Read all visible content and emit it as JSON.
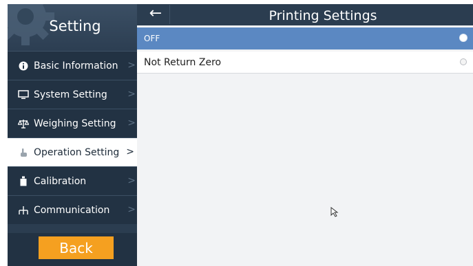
{
  "sidebar": {
    "title": "Setting",
    "items": [
      {
        "label": "Basic Information",
        "icon": "info-icon",
        "active": false
      },
      {
        "label": "System Setting",
        "icon": "monitor-icon",
        "active": false
      },
      {
        "label": "Weighing Setting",
        "icon": "scale-icon",
        "active": false
      },
      {
        "label": "Operation Setting",
        "icon": "hand-icon",
        "active": true
      },
      {
        "label": "Calibration",
        "icon": "weight-icon",
        "active": false
      },
      {
        "label": "Communication",
        "icon": "network-icon",
        "active": false
      }
    ],
    "chevron": ">",
    "back_label": "Back"
  },
  "header": {
    "back_arrow": "←",
    "title": "Printing Settings"
  },
  "options": [
    {
      "label": "OFF",
      "selected": true
    },
    {
      "label": "Not Return Zero",
      "selected": false
    }
  ],
  "colors": {
    "sidebar_bg": "#223243",
    "header_bg": "#2b3d50",
    "selected_row": "#5b88c2",
    "back_button": "#f5a020"
  }
}
